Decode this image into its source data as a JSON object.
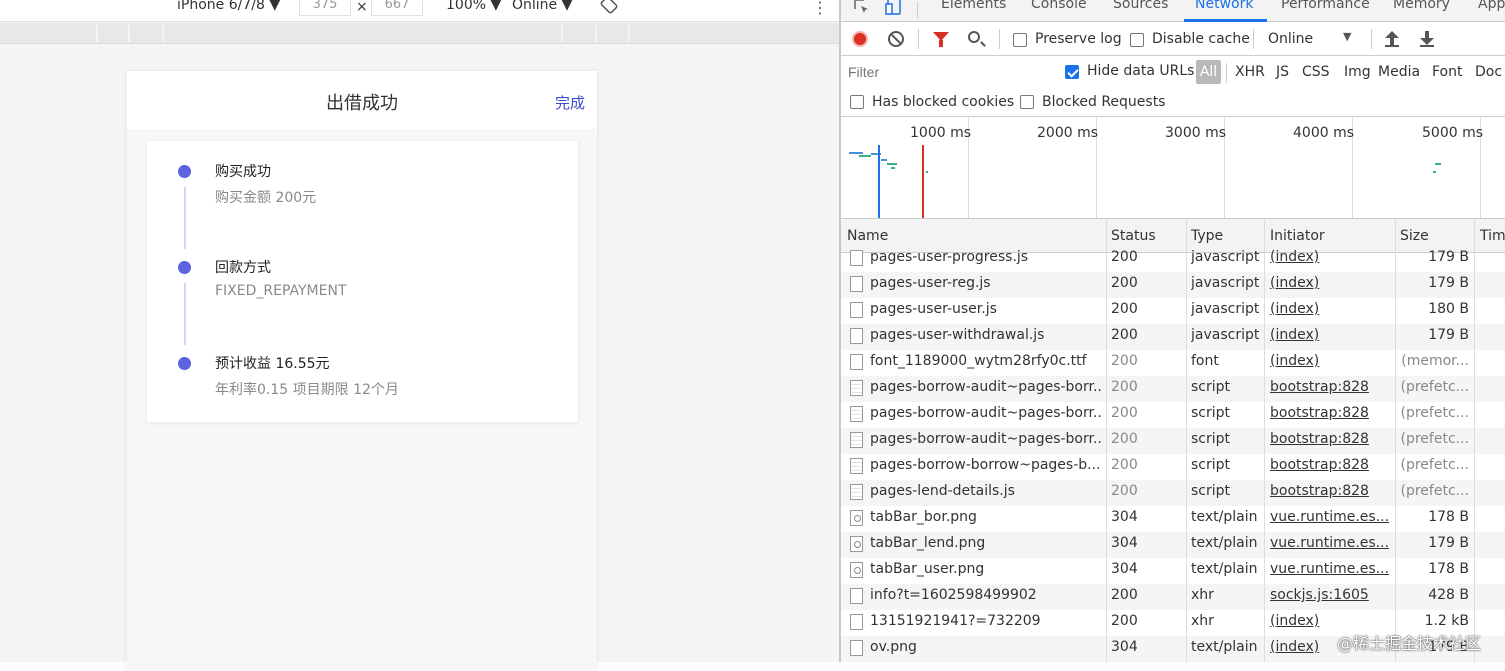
{
  "device_toolbar": {
    "device": "iPhone 6/7/8 ▼",
    "width": "375",
    "times": "×",
    "height": "667",
    "zoom": "100% ▼",
    "throttle": "Online ▼"
  },
  "phone": {
    "title": "出借成功",
    "done": "完成",
    "steps": [
      {
        "title": "购买成功",
        "sub": "购买金额 200元"
      },
      {
        "title": "回款方式",
        "sub": "FIXED_REPAYMENT"
      },
      {
        "title": "预计收益 16.55元",
        "sub": "年利率0.15 项目期限 12个月"
      }
    ],
    "accent": "#5b63e0"
  },
  "devtools": {
    "tabs": [
      "Elements",
      "Console",
      "Sources",
      "Network",
      "Performance",
      "Memory",
      "App"
    ],
    "active_tab": "Network",
    "toolbar": {
      "preserve_log": "Preserve log",
      "disable_cache": "Disable cache",
      "throttle": "Online"
    },
    "filter": {
      "placeholder": "Filter",
      "hide_data_urls": "Hide data URLs",
      "all": "All",
      "types": [
        "XHR",
        "JS",
        "CSS",
        "Img",
        "Media",
        "Font",
        "Doc"
      ]
    },
    "blocked": {
      "cookies": "Has blocked cookies",
      "requests": "Blocked Requests"
    },
    "timeline_labels": [
      "1000 ms",
      "2000 ms",
      "3000 ms",
      "4000 ms",
      "5000 ms"
    ],
    "columns": [
      "Name",
      "Status",
      "Type",
      "Initiator",
      "Size",
      "Tim"
    ],
    "rows": [
      {
        "name": "pages-user-progress.js",
        "status": "200",
        "type": "javascript",
        "initiator": "(index)",
        "size": "179 B",
        "icon": "file",
        "muted": false
      },
      {
        "name": "pages-user-reg.js",
        "status": "200",
        "type": "javascript",
        "initiator": "(index)",
        "size": "179 B",
        "icon": "file",
        "muted": false
      },
      {
        "name": "pages-user-user.js",
        "status": "200",
        "type": "javascript",
        "initiator": "(index)",
        "size": "180 B",
        "icon": "file",
        "muted": false
      },
      {
        "name": "pages-user-withdrawal.js",
        "status": "200",
        "type": "javascript",
        "initiator": "(index)",
        "size": "179 B",
        "icon": "file",
        "muted": false
      },
      {
        "name": "font_1189000_wytm28rfy0c.ttf",
        "status": "200",
        "type": "font",
        "initiator": "(index)",
        "size": "(memor...",
        "icon": "file",
        "muted": true
      },
      {
        "name": "pages-borrow-audit~pages-borr...",
        "status": "200",
        "type": "script",
        "initiator": "bootstrap:828",
        "size": "(prefetc...",
        "icon": "script",
        "muted": true
      },
      {
        "name": "pages-borrow-audit~pages-borr...",
        "status": "200",
        "type": "script",
        "initiator": "bootstrap:828",
        "size": "(prefetc...",
        "icon": "script",
        "muted": true
      },
      {
        "name": "pages-borrow-audit~pages-borr...",
        "status": "200",
        "type": "script",
        "initiator": "bootstrap:828",
        "size": "(prefetc...",
        "icon": "script",
        "muted": true
      },
      {
        "name": "pages-borrow-borrow~pages-b...",
        "status": "200",
        "type": "script",
        "initiator": "bootstrap:828",
        "size": "(prefetc...",
        "icon": "script",
        "muted": true
      },
      {
        "name": "pages-lend-details.js",
        "status": "200",
        "type": "script",
        "initiator": "bootstrap:828",
        "size": "(prefetc...",
        "icon": "script",
        "muted": true
      },
      {
        "name": "tabBar_bor.png",
        "status": "304",
        "type": "text/plain",
        "initiator": "vue.runtime.es...",
        "size": "178 B",
        "icon": "img",
        "muted": false
      },
      {
        "name": "tabBar_lend.png",
        "status": "304",
        "type": "text/plain",
        "initiator": "vue.runtime.es...",
        "size": "179 B",
        "icon": "img",
        "muted": false
      },
      {
        "name": "tabBar_user.png",
        "status": "304",
        "type": "text/plain",
        "initiator": "vue.runtime.es...",
        "size": "178 B",
        "icon": "img",
        "muted": false
      },
      {
        "name": "info?t=1602598499902",
        "status": "200",
        "type": "xhr",
        "initiator": "sockjs.js:1605",
        "size": "428 B",
        "icon": "file",
        "muted": false
      },
      {
        "name": "13151921941?=732209",
        "status": "200",
        "type": "xhr",
        "initiator": "(index)",
        "size": "1.2 kB",
        "icon": "file",
        "muted": false
      },
      {
        "name": "ov.png",
        "status": "304",
        "type": "text/plain",
        "initiator": "(index)",
        "size": "179 B",
        "icon": "file",
        "muted": false
      }
    ],
    "watermark": "@稀土掘金技术社区"
  }
}
